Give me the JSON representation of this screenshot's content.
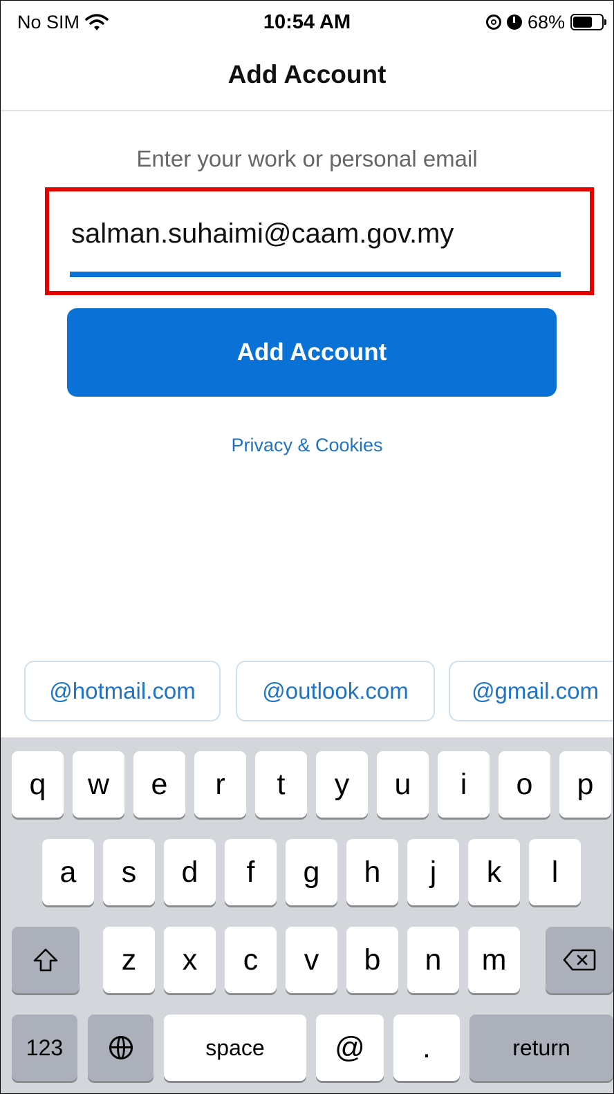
{
  "status_bar": {
    "carrier": "No SIM",
    "time": "10:54 AM",
    "battery_percent": "68%",
    "battery_level": 0.68,
    "icons": [
      "wifi-icon",
      "orientation-lock-icon",
      "alarm-icon",
      "battery-icon"
    ]
  },
  "navbar": {
    "title": "Add Account"
  },
  "form": {
    "prompt": "Enter your work or personal email",
    "email_value": "salman.suhaimi@caam.gov.my",
    "add_button": "Add Account",
    "privacy_link": "Privacy & Cookies"
  },
  "suggestions": [
    "@hotmail.com",
    "@outlook.com",
    "@gmail.com"
  ],
  "keyboard": {
    "row1": [
      "q",
      "w",
      "e",
      "r",
      "t",
      "y",
      "u",
      "i",
      "o",
      "p"
    ],
    "row2": [
      "a",
      "s",
      "d",
      "f",
      "g",
      "h",
      "j",
      "k",
      "l"
    ],
    "row3": [
      "z",
      "x",
      "c",
      "v",
      "b",
      "n",
      "m"
    ],
    "row4": {
      "numbers": "123",
      "space": "space",
      "at": "@",
      "dot": ".",
      "return": "return"
    },
    "icons": [
      "shift-icon",
      "backspace-icon",
      "globe-icon"
    ]
  },
  "colors": {
    "accent": "#0a72d6",
    "link": "#1f73c7",
    "highlight_box": "#e60000",
    "keyboard_bg": "#d3d6db"
  }
}
